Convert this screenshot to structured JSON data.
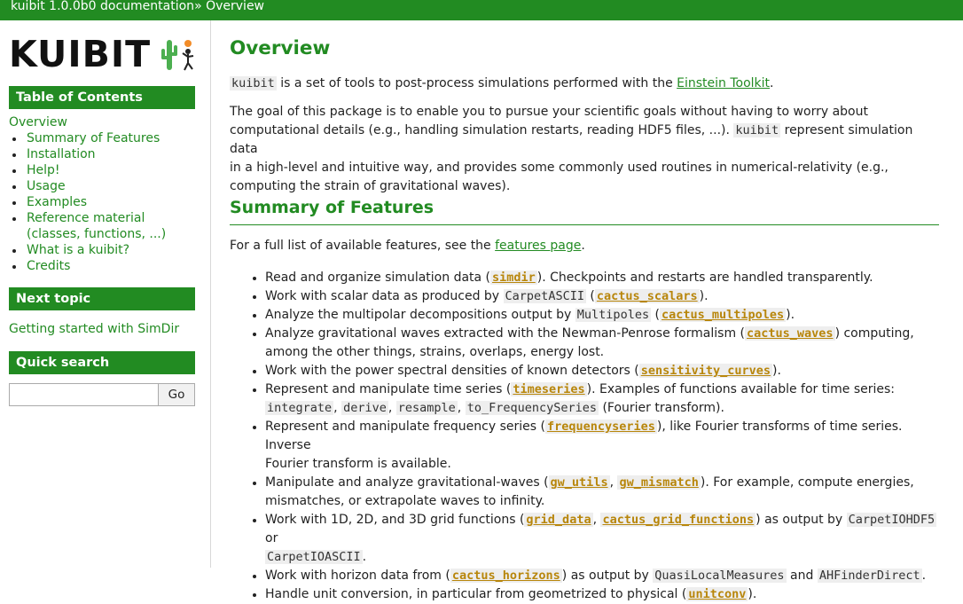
{
  "topbar": {
    "doc_title": "kuibit 1.0.0b0 documentation",
    "sep": " »",
    "page": "Overview"
  },
  "logo": {
    "text": "KUIBIT"
  },
  "colors": {
    "brand_green": "#228b22",
    "xref_gold": "#b8860b"
  },
  "sidebar": {
    "toc_title": "Table of Contents",
    "toc_top": "Overview",
    "toc_items": [
      "Summary of Features",
      "Installation",
      "Help!",
      "Usage",
      "Examples",
      "Reference material",
      "(classes, functions, ...)",
      "What is a kuibit?",
      "Credits"
    ],
    "next_title": "Next topic",
    "next_link": "Getting started with SimDir",
    "search_title": "Quick search",
    "search_value": "",
    "search_button": "Go"
  },
  "main": {
    "title": "Overview",
    "p1": {
      "code": "kuibit",
      "text": " is a set of tools to post-process simulations performed with the ",
      "link": "Einstein Toolkit",
      "end": "."
    },
    "p2": {
      "line1": "The goal of this package is to enable you to pursue your scientific goals without having to worry about",
      "line2a": "computational details (e.g., handling simulation restarts, reading HDF5 files, ...). ",
      "code": "kuibit",
      "line2b": " represent simulation data",
      "line3": "in a high-level and intuitive way, and provides some commonly used routines in numerical-relativity (e.g.,",
      "line4": "computing the strain of gravitational waves)."
    },
    "section_title": "Summary of Features",
    "p3": {
      "text": "For a full list of available features, see the ",
      "link": "features page",
      "end": "."
    },
    "features": {
      "f1": {
        "a": "Read and organize simulation data (",
        "x1": "simdir",
        "b": "). Checkpoints and restarts are handled transparently."
      },
      "f2": {
        "a": "Work with scalar data as produced by ",
        "c1": "CarpetASCII",
        "b": " (",
        "x1": "cactus_scalars",
        "d": ")."
      },
      "f3": {
        "a": "Analyze the multipolar decompositions output by ",
        "c1": "Multipoles",
        "b": " (",
        "x1": "cactus_multipoles",
        "d": ")."
      },
      "f4": {
        "a": "Analyze gravitational waves extracted with the Newman-Penrose formalism (",
        "x1": "cactus_waves",
        "b": ") computing,",
        "c": "among the other things, strains, overlaps, energy lost."
      },
      "f5": {
        "a": "Work with the power spectral densities of known detectors (",
        "x1": "sensitivity_curves",
        "b": ")."
      },
      "f6": {
        "a": "Represent and manipulate time series (",
        "x1": "timeseries",
        "b": "). Examples of functions available for time series:",
        "c1": "integrate",
        "c2": "derive",
        "c3": "resample",
        "c4": "to_FrequencySeries",
        "sep": ", ",
        "d": " (Fourier transform)."
      },
      "f7": {
        "a": "Represent and manipulate frequency series (",
        "x1": "frequencyseries",
        "b": "), like Fourier transforms of time series. Inverse",
        "c": "Fourier transform is available."
      },
      "f8": {
        "a": "Manipulate and analyze gravitational-waves (",
        "x1": "gw_utils",
        "sep": ", ",
        "x2": "gw_mismatch",
        "b": "). For example, compute energies,",
        "c": "mismatches, or extrapolate waves to infinity."
      },
      "f9": {
        "a": "Work with 1D, 2D, and 3D grid functions (",
        "x1": "grid_data",
        "sep": ", ",
        "x2": "cactus_grid_functions",
        "b": ") as output by ",
        "c1": "CarpetIOHDF5",
        "c": " or",
        "c2": "CarpetIOASCII",
        "d": "."
      },
      "f10": {
        "a": "Work with horizon data from (",
        "x1": "cactus_horizons",
        "b": ") as output by ",
        "c1": "QuasiLocalMeasures",
        "c": " and ",
        "c2": "AHFinderDirect",
        "d": "."
      },
      "f11": {
        "a": "Handle unit conversion, in particular from geometrized to physical (",
        "x1": "unitconv",
        "b": ")."
      }
    }
  }
}
